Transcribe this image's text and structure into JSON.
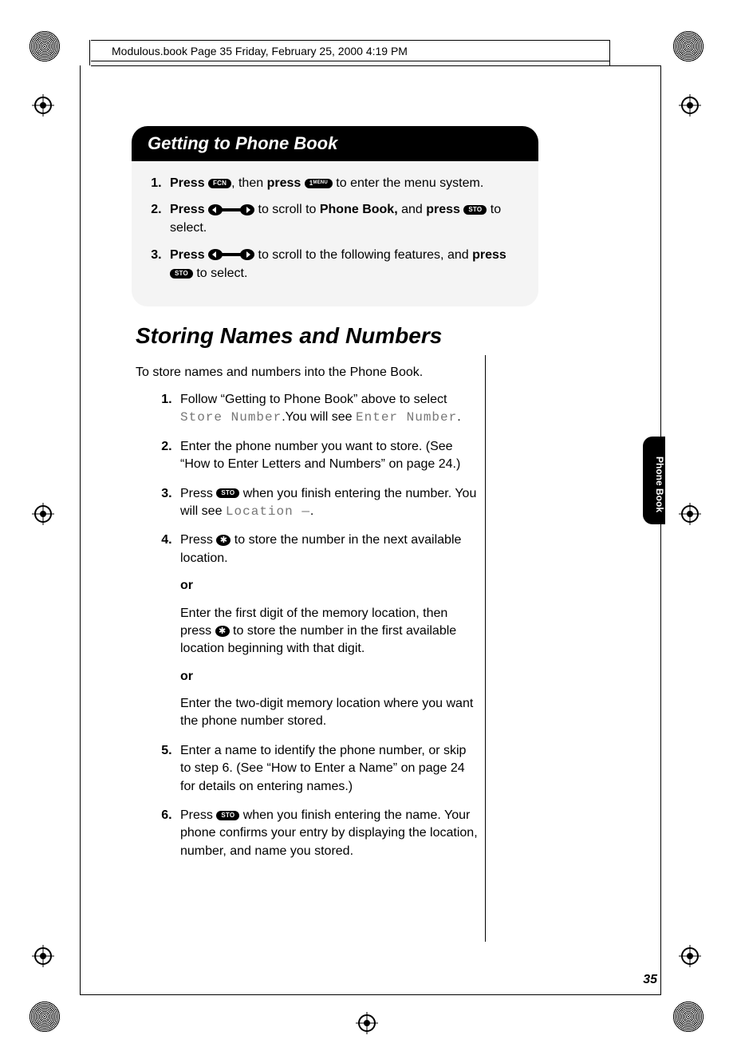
{
  "header": {
    "running_head": "Modulous.book  Page 35  Friday, February 25, 2000  4:19 PM"
  },
  "callout": {
    "title": "Getting to Phone Book",
    "step1_a": "Press ",
    "step1_b": ", then ",
    "step1_press2": "press",
    "step1_c": " to enter the menu system.",
    "step2_a": "Press ",
    "step2_b": " to scroll to ",
    "step2_target": "Phone Book,",
    "step2_c": " and ",
    "step2_press2": "press",
    "step2_d": " to select.",
    "step3_a": "Press ",
    "step3_b": " to scroll to the following features, and ",
    "step3_press2": "press",
    "step3_c": " to select.",
    "btn_fcn": "FCN",
    "btn_menu": "MENU",
    "btn_sto": "STO",
    "btn_1": "1"
  },
  "section": {
    "title": "Storing Names and Numbers",
    "intro": "To store names and numbers into the Phone Book."
  },
  "steps": {
    "s1_a": "Follow “Getting to Phone Book” above to select ",
    "s1_lcd1": "Store Number",
    "s1_b": ".You will see ",
    "s1_lcd2": "Enter Number",
    "s1_c": ".",
    "s2": "Enter the phone number you want to store. (See “How to Enter Letters and Numbers” on page 24.)",
    "s3_a": "Press ",
    "s3_b": " when you finish entering the number. You will see ",
    "s3_lcd": "Location —",
    "s3_c": ".",
    "s4_a": "Press ",
    "s4_b": " to store the number in the next available location.",
    "or": "or",
    "s4_alt1_a": "Enter the first digit of the memory location, then press ",
    "s4_alt1_b": " to store the number in the first available location beginning with that digit.",
    "s4_alt2": "Enter the two-digit memory location where you want the phone number stored.",
    "s5": "Enter a name to identify the phone number, or skip to step 6. (See “How to Enter a Name” on page 24 for details on entering names.)",
    "s6_a": "Press ",
    "s6_b": " when you finish entering the name. Your phone confirms your entry by displaying the location, number, and name you stored."
  },
  "tab": {
    "label": "Phone Book"
  },
  "footer": {
    "page": "35"
  },
  "buttons": {
    "sto": "STO",
    "star": "✱"
  }
}
